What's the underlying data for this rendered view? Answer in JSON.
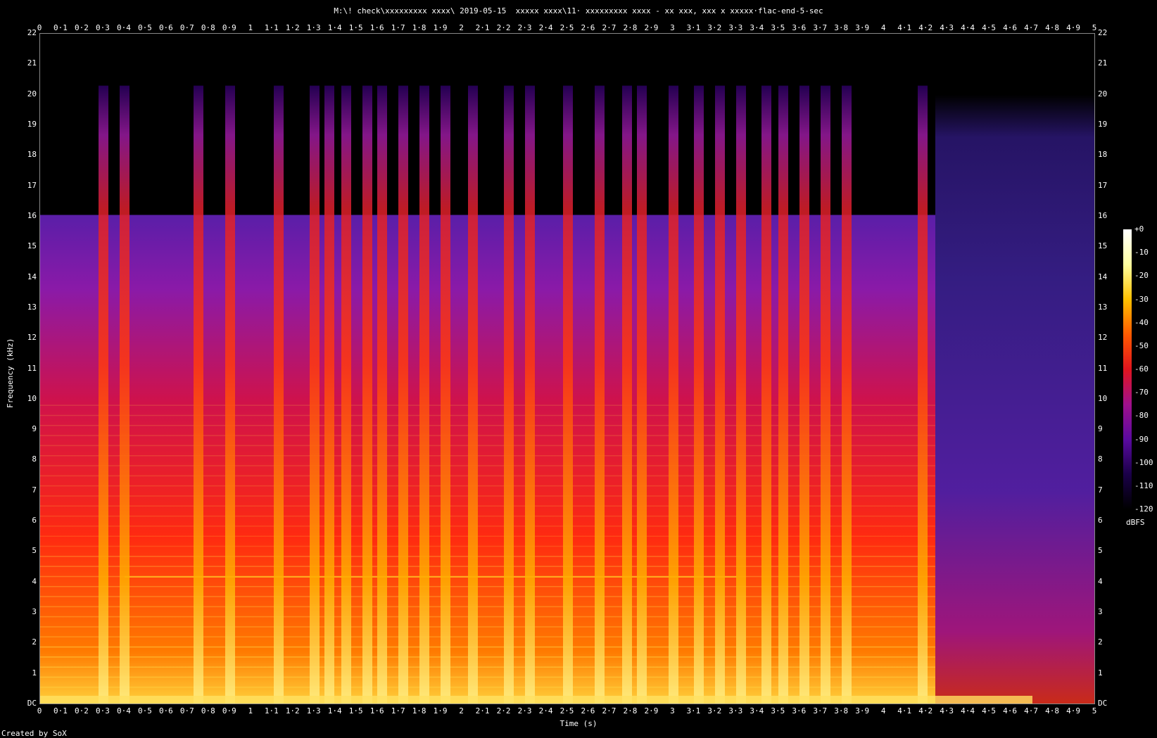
{
  "title": "M:\\! check\\xxxxxxxxx xxxx\\ 2019-05-15  xxxxx xxxx\\11· xxxxxxxxx xxxx - xx xxx, xxx x xxxxx·flac-end-5-sec",
  "footer": "Created by SoX",
  "chart_data": {
    "type": "heatmap",
    "title": "M:\\! check\\xxxxxxxxx xxxx\\ 2019-05-15  xxxxx xxxx\\11· xxxxxxxxx xxxx - xx xxx, xxx x xxxxx·flac-end-5-sec",
    "xlabel": "Time (s)",
    "ylabel": "Frequency (kHz)",
    "xlim": [
      0,
      5
    ],
    "ylim": [
      0,
      22
    ],
    "x_ticks": [
      "0",
      "0·1",
      "0·2",
      "0·3",
      "0·4",
      "0·5",
      "0·6",
      "0·7",
      "0·8",
      "0·9",
      "1",
      "1·1",
      "1·2",
      "1·3",
      "1·4",
      "1·5",
      "1·6",
      "1·7",
      "1·8",
      "1·9",
      "2",
      "2·1",
      "2·2",
      "2·3",
      "2·4",
      "2·5",
      "2·6",
      "2·7",
      "2·8",
      "2·9",
      "3",
      "3·1",
      "3·2",
      "3·3",
      "3·4",
      "3·5",
      "3·6",
      "3·7",
      "3·8",
      "3·9",
      "4",
      "4·1",
      "4·2",
      "4·3",
      "4·4",
      "4·5",
      "4·6",
      "4·7",
      "4·8",
      "4·9",
      "5"
    ],
    "y_ticks": [
      "DC",
      "1",
      "2",
      "3",
      "4",
      "5",
      "6",
      "7",
      "8",
      "9",
      "10",
      "11",
      "12",
      "13",
      "14",
      "15",
      "16",
      "17",
      "18",
      "19",
      "20",
      "21",
      "22"
    ],
    "colorbar": {
      "label": "dBFS",
      "ticks": [
        "+0",
        "-10",
        "-20",
        "-30",
        "-40",
        "-50",
        "-60",
        "-70",
        "-80",
        "-90",
        "-100",
        "-110",
        "-120"
      ],
      "range": [
        -120,
        0
      ],
      "colors": [
        "#000000",
        "#1a0048",
        "#5a0aa0",
        "#a0108c",
        "#e0141e",
        "#ff5a00",
        "#ffc000",
        "#ffffa0",
        "#ffffff"
      ]
    },
    "spectrum": {
      "lowpass_cutoff_khz": 16,
      "music_end_s": 4.24,
      "transients_s": [
        0.3,
        0.4,
        0.75,
        0.9,
        1.13,
        1.3,
        1.37,
        1.45,
        1.55,
        1.62,
        1.72,
        1.82,
        1.92,
        2.05,
        2.22,
        2.32,
        2.5,
        2.65,
        2.78,
        2.85,
        3.0,
        3.12,
        3.22,
        3.32,
        3.44,
        3.52,
        3.62,
        3.72,
        3.82,
        4.18
      ],
      "sustained_tone_khz": 4.2,
      "sustained_tone_range_s": [
        0.4,
        3.3
      ]
    }
  }
}
